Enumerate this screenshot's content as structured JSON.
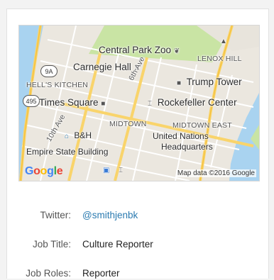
{
  "map": {
    "labels": {
      "central_park_zoo": "Central Park Zoo",
      "lenox_hill": "LENOX HILL",
      "carnegie_hall": "Carnegie Hall",
      "hells_kitchen": "HELL'S KITCHEN",
      "trump_tower": "Trump Tower",
      "sixth_ave": "6th Ave",
      "times_square": "Times Square",
      "rockefeller_center": "Rockefeller Center",
      "tenth_ave": "10th Ave",
      "midtown": "MIDTOWN",
      "midtown_east": "MIDTOWN EAST",
      "bh": "B&H",
      "united_nations": "United Nations",
      "headquarters": "Headquarters",
      "empire_state": "Empire State Building",
      "route_9a": "9A",
      "route_495": "495"
    },
    "google_letters": [
      "G",
      "o",
      "o",
      "g",
      "l",
      "e"
    ],
    "attribution": "Map data ©2016 Google"
  },
  "profile": {
    "twitter_label": "Twitter:",
    "twitter_value": "@smithjenbk",
    "job_title_label": "Job Title:",
    "job_title_value": "Culture Reporter",
    "job_roles_label": "Job Roles:",
    "job_roles_value": "Reporter"
  },
  "colors": {
    "link": "#2a7ab0",
    "park": "#c9e4a4",
    "water": "#a9d3f0",
    "road_major": "#f9d46b"
  }
}
